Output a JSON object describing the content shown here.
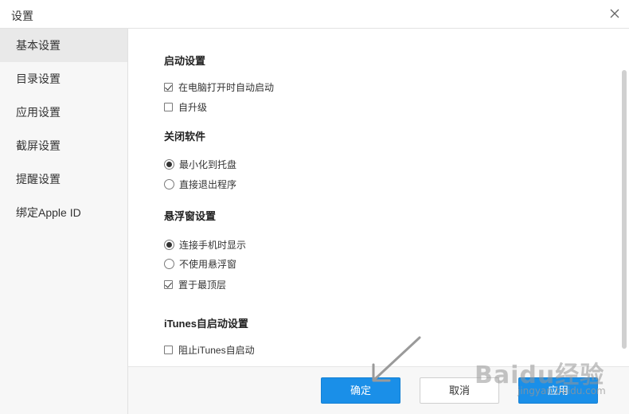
{
  "window": {
    "title": "设置",
    "close_icon": "close-icon"
  },
  "sidebar": {
    "items": [
      {
        "label": "基本设置",
        "active": true
      },
      {
        "label": "目录设置",
        "active": false
      },
      {
        "label": "应用设置",
        "active": false
      },
      {
        "label": "截屏设置",
        "active": false
      },
      {
        "label": "提醒设置",
        "active": false
      },
      {
        "label": "绑定Apple ID",
        "active": false
      }
    ]
  },
  "sections": {
    "startup": {
      "title": "启动设置",
      "auto_start": {
        "label": "在电脑打开时自动启动",
        "checked": true
      },
      "auto_upgrade": {
        "label": "自升级",
        "checked": false
      }
    },
    "close": {
      "title": "关闭软件",
      "minimize_tray": {
        "label": "最小化到托盘",
        "selected": true
      },
      "exit_app": {
        "label": "直接退出程序",
        "selected": false
      }
    },
    "float_window": {
      "title": "悬浮窗设置",
      "show_on_connect": {
        "label": "连接手机时显示",
        "selected": true
      },
      "never_show": {
        "label": "不使用悬浮窗",
        "selected": false
      },
      "always_on_top": {
        "label": "置于最顶层",
        "checked": true
      }
    },
    "itunes": {
      "title": "iTunes自启动设置",
      "block_itunes": {
        "label": "阻止iTunes自启动",
        "checked": false
      }
    }
  },
  "footer": {
    "ok_label": "确定",
    "cancel_label": "取消",
    "apply_label": "应用"
  },
  "watermark": {
    "logo": "Baidu经验",
    "url": "jingyan.baidu.com"
  },
  "colors": {
    "primary": "#1a8fe8",
    "sidebar_bg": "#f7f7f7",
    "sidebar_active": "#e9e9e9"
  }
}
